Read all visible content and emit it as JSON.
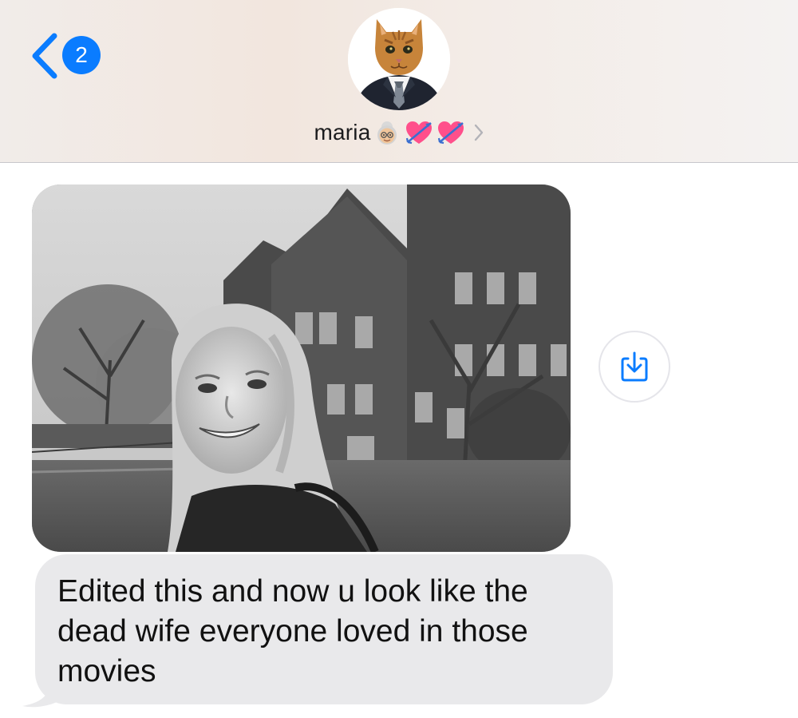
{
  "header": {
    "back_badge_count": "2",
    "contact_name": "maria",
    "contact_emojis": [
      "old-woman-emoji",
      "heart-with-arrow-emoji",
      "heart-with-arrow-emoji"
    ],
    "avatar": "cat-in-suit-avatar"
  },
  "messages": [
    {
      "type": "photo",
      "direction": "incoming",
      "description_icon": "save-to-photos-icon"
    },
    {
      "type": "text",
      "direction": "incoming",
      "text": "Edited this and now u look like the dead wife everyone loved in those movies"
    }
  ],
  "colors": {
    "accent": "#0a7cff",
    "incoming_bubble": "#e9e9eb",
    "header_bg": "#f2ebe6"
  }
}
